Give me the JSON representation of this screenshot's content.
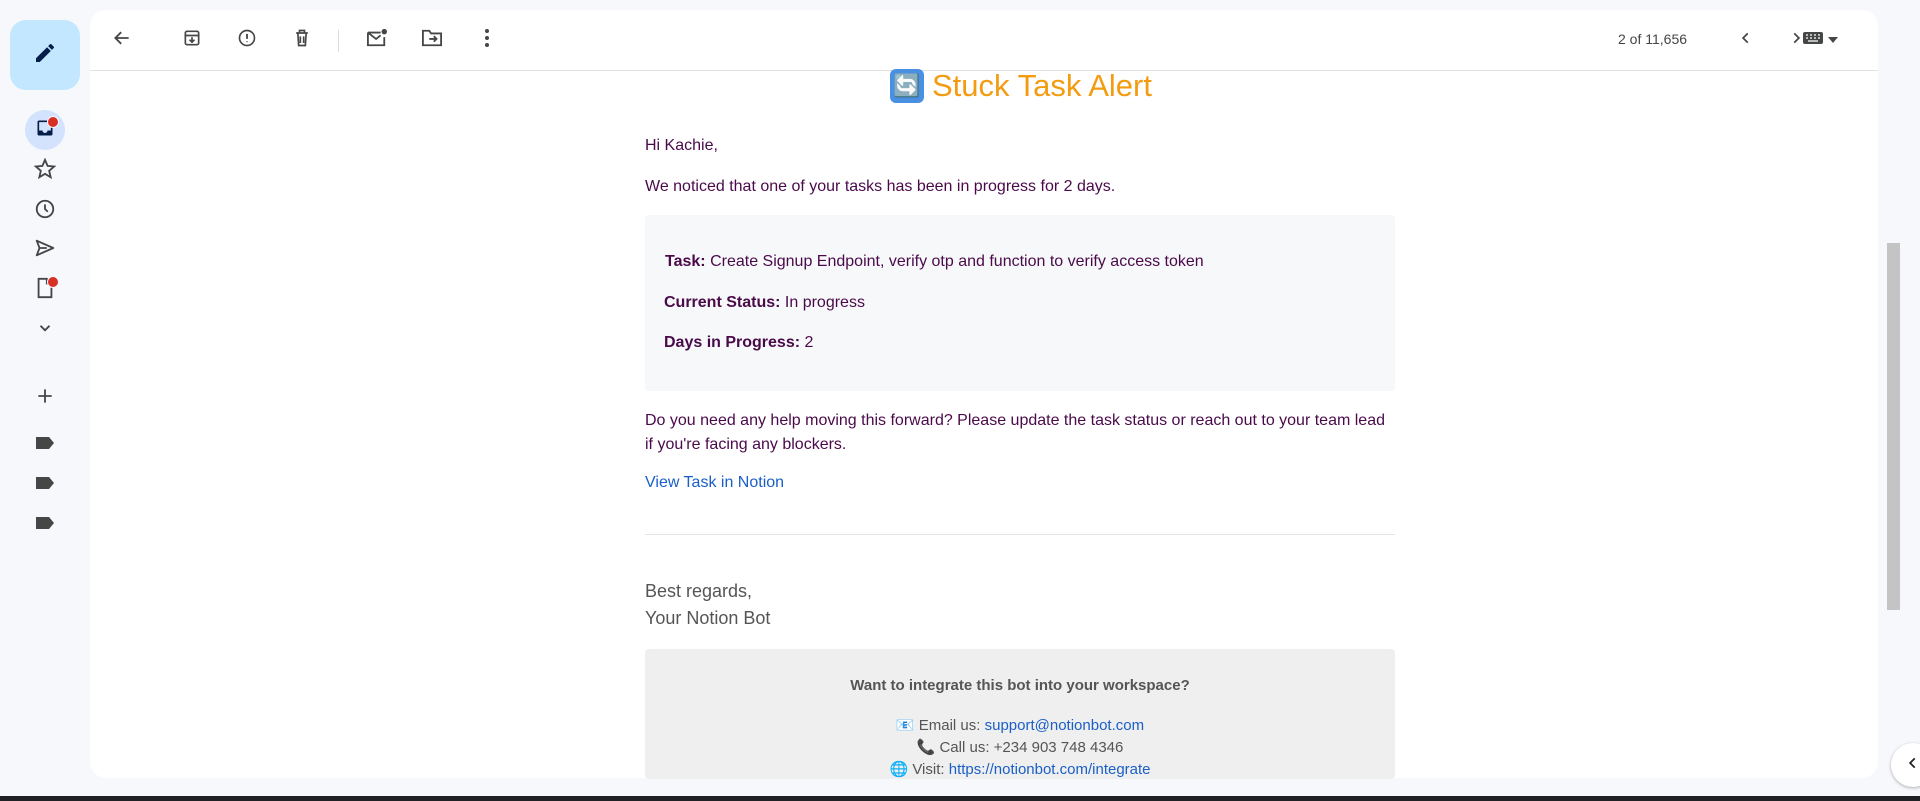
{
  "toolbar": {
    "pager_text": "2 of 11,656"
  },
  "email": {
    "title_emoji": "🔄",
    "title": "Stuck Task Alert",
    "greeting": "Hi Kachie,",
    "intro": "We noticed that one of your tasks has been in progress for 2 days.",
    "task_label": "Task:",
    "task_value": "Create Signup Endpoint, verify otp and function to verify access token",
    "status_label": "Current Status:",
    "status_value": "In progress",
    "days_label": "Days in Progress:",
    "days_value": "2",
    "help_text": "Do you need any help moving this forward? Please update the task status or reach out to your team lead if you're facing any blockers.",
    "notion_link": "View Task in Notion",
    "regards_line1": "Best regards,",
    "regards_line2": "Your Notion Bot",
    "footer": {
      "question": "Want to integrate this bot into your workspace?",
      "email_icon": "📧",
      "email_label": "Email us:",
      "email_value": "support@notionbot.com",
      "phone_icon": "📞",
      "phone_label": "Call us: +234 903 748 4346",
      "web_icon": "🌐",
      "web_label": "Visit:",
      "web_value": "https://notionbot.com/integrate"
    }
  },
  "colors": {
    "accent_title": "#f39c12",
    "body_text": "#4a0a4a",
    "link": "#1a5fc7",
    "compose_bg": "#c2e7ff"
  }
}
